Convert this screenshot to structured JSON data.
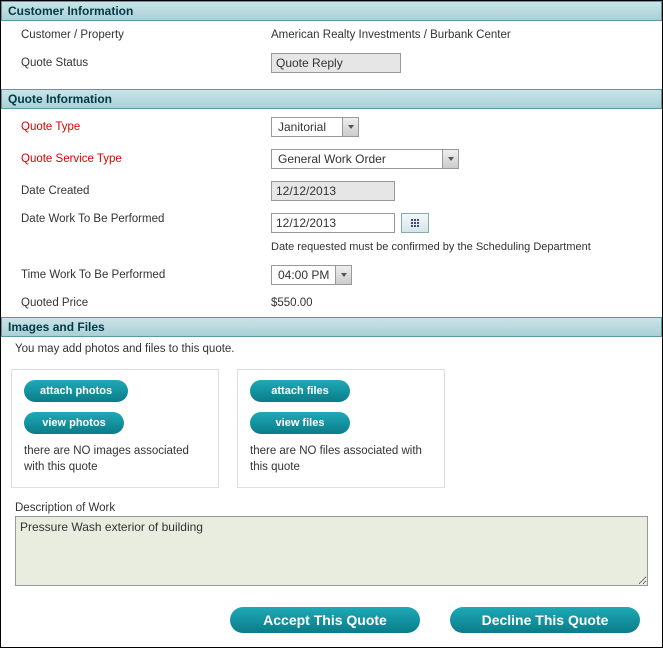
{
  "sections": {
    "customer": {
      "title": "Customer Information"
    },
    "quote": {
      "title": "Quote Information"
    },
    "files": {
      "title": "Images and Files"
    }
  },
  "customer_info": {
    "customer_label": "Customer / Property",
    "customer_value": "American Realty Investments / Burbank Center",
    "status_label": "Quote Status",
    "status_value": "Quote Reply"
  },
  "quote_info": {
    "type_label": "Quote Type",
    "type_value": "Janitorial",
    "service_type_label": "Quote Service Type",
    "service_type_value": "General Work Order",
    "date_created_label": "Date Created",
    "date_created_value": "12/12/2013",
    "date_work_label": "Date Work To Be Performed",
    "date_work_value": "12/12/2013",
    "date_work_note": "Date requested must be confirmed by the Scheduling Department",
    "time_work_label": "Time Work To Be Performed",
    "time_work_value": "04:00 PM",
    "price_label": "Quoted Price",
    "price_value": "$550.00"
  },
  "files": {
    "intro": "You may add photos and files to this quote.",
    "attach_photos": "attach photos",
    "view_photos": "view photos",
    "photos_msg": "there are NO images associated with this quote",
    "attach_files": "attach files",
    "view_files": "view files",
    "files_msg": "there are NO files associated with this quote"
  },
  "description": {
    "label": "Description of Work",
    "value": "Pressure Wash exterior of building"
  },
  "actions": {
    "accept": "Accept This Quote",
    "decline": "Decline This Quote"
  }
}
